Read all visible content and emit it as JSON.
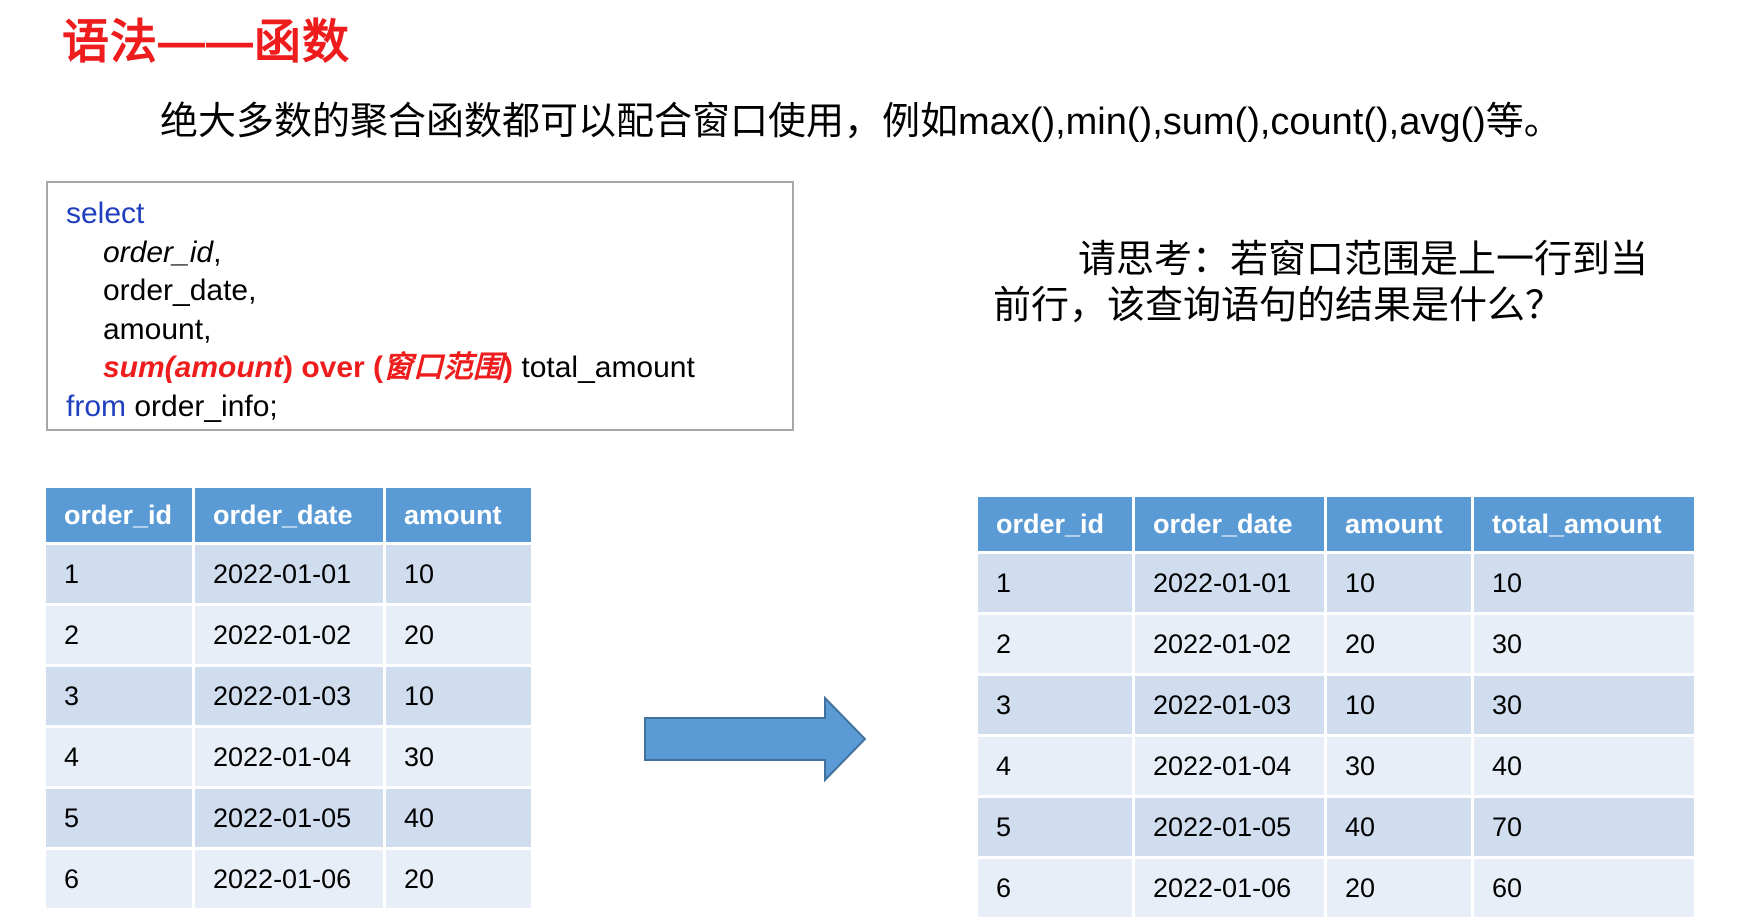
{
  "title": "语法——函数",
  "subtitle": "绝大多数的聚合函数都可以配合窗口使用，例如max(),min(),sum(),count(),avg()等。",
  "code": {
    "select": "select",
    "col1": "order_id",
    "comma1": ",",
    "col2": "order_date,",
    "col3": "amount,",
    "fn": "sum(amount",
    "paren_close": ")",
    "over": " over (",
    "window": "窗口范围",
    "paren_close2": ")",
    "alias": " total_amount",
    "from": "from",
    "table": " order_info;"
  },
  "question": {
    "line1": "请思考：若窗口范围是上一行到当",
    "line2": "前行，该查询语句的结果是什么？"
  },
  "colors": {
    "title": "#ee1c1c",
    "keyword": "#1f3fbf",
    "header": "#5b9bd5",
    "row_odd": "#d0ddee",
    "row_even": "#e8eef7",
    "arrow": "#5b9bd5"
  },
  "arrow_icon": "right-arrow-icon",
  "table_input": {
    "headers": [
      "order_id",
      "order_date",
      "amount"
    ],
    "rows": [
      [
        "1",
        "2022-01-01",
        "10"
      ],
      [
        "2",
        "2022-01-02",
        "20"
      ],
      [
        "3",
        "2022-01-03",
        "10"
      ],
      [
        "4",
        "2022-01-04",
        "30"
      ],
      [
        "5",
        "2022-01-05",
        "40"
      ],
      [
        "6",
        "2022-01-06",
        "20"
      ]
    ]
  },
  "table_output": {
    "headers": [
      "order_id",
      "order_date",
      "amount",
      "total_amount"
    ],
    "rows": [
      [
        "1",
        "2022-01-01",
        "10",
        "10"
      ],
      [
        "2",
        "2022-01-02",
        "20",
        "30"
      ],
      [
        "3",
        "2022-01-03",
        "10",
        "30"
      ],
      [
        "4",
        "2022-01-04",
        "30",
        "40"
      ],
      [
        "5",
        "2022-01-05",
        "40",
        "70"
      ],
      [
        "6",
        "2022-01-06",
        "20",
        "60"
      ]
    ]
  }
}
